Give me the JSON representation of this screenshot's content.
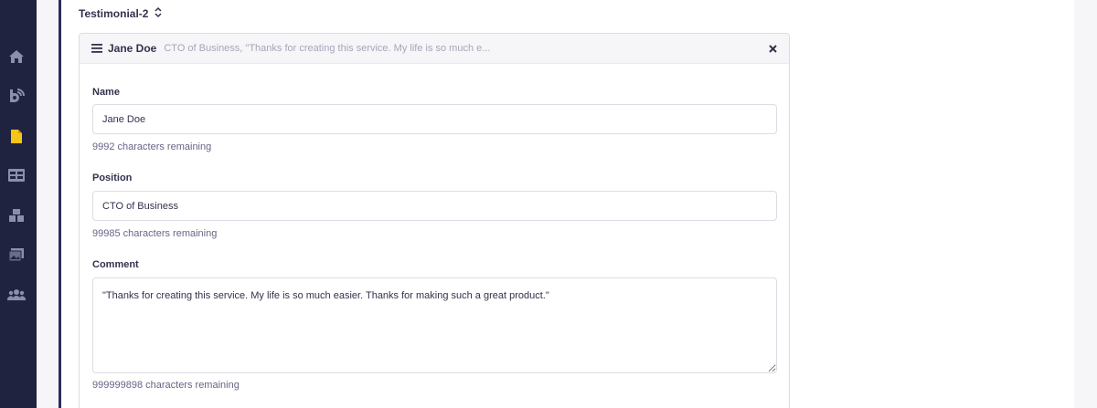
{
  "sidebar": {
    "icons": [
      "home-icon",
      "blog-icon",
      "document-icon",
      "layout-icon",
      "cubes-icon",
      "media-icon",
      "users-icon"
    ],
    "active_color": "#f5c518",
    "bg_color": "#1f2340"
  },
  "section": {
    "title": "Testimonial-2"
  },
  "card": {
    "header": {
      "name": "Jane Doe",
      "summary": "CTO of Business, \"Thanks for creating this service. My life is so much e..."
    },
    "fields": {
      "name": {
        "label": "Name",
        "value": "Jane Doe",
        "hint": "9992 characters remaining"
      },
      "position": {
        "label": "Position",
        "value": "CTO of Business",
        "hint": "99985 characters remaining"
      },
      "comment": {
        "label": "Comment",
        "value": "\"Thanks for creating this service. My life is so much easier. Thanks for making such a great product.\"",
        "hint": "999999898 characters remaining"
      }
    }
  }
}
